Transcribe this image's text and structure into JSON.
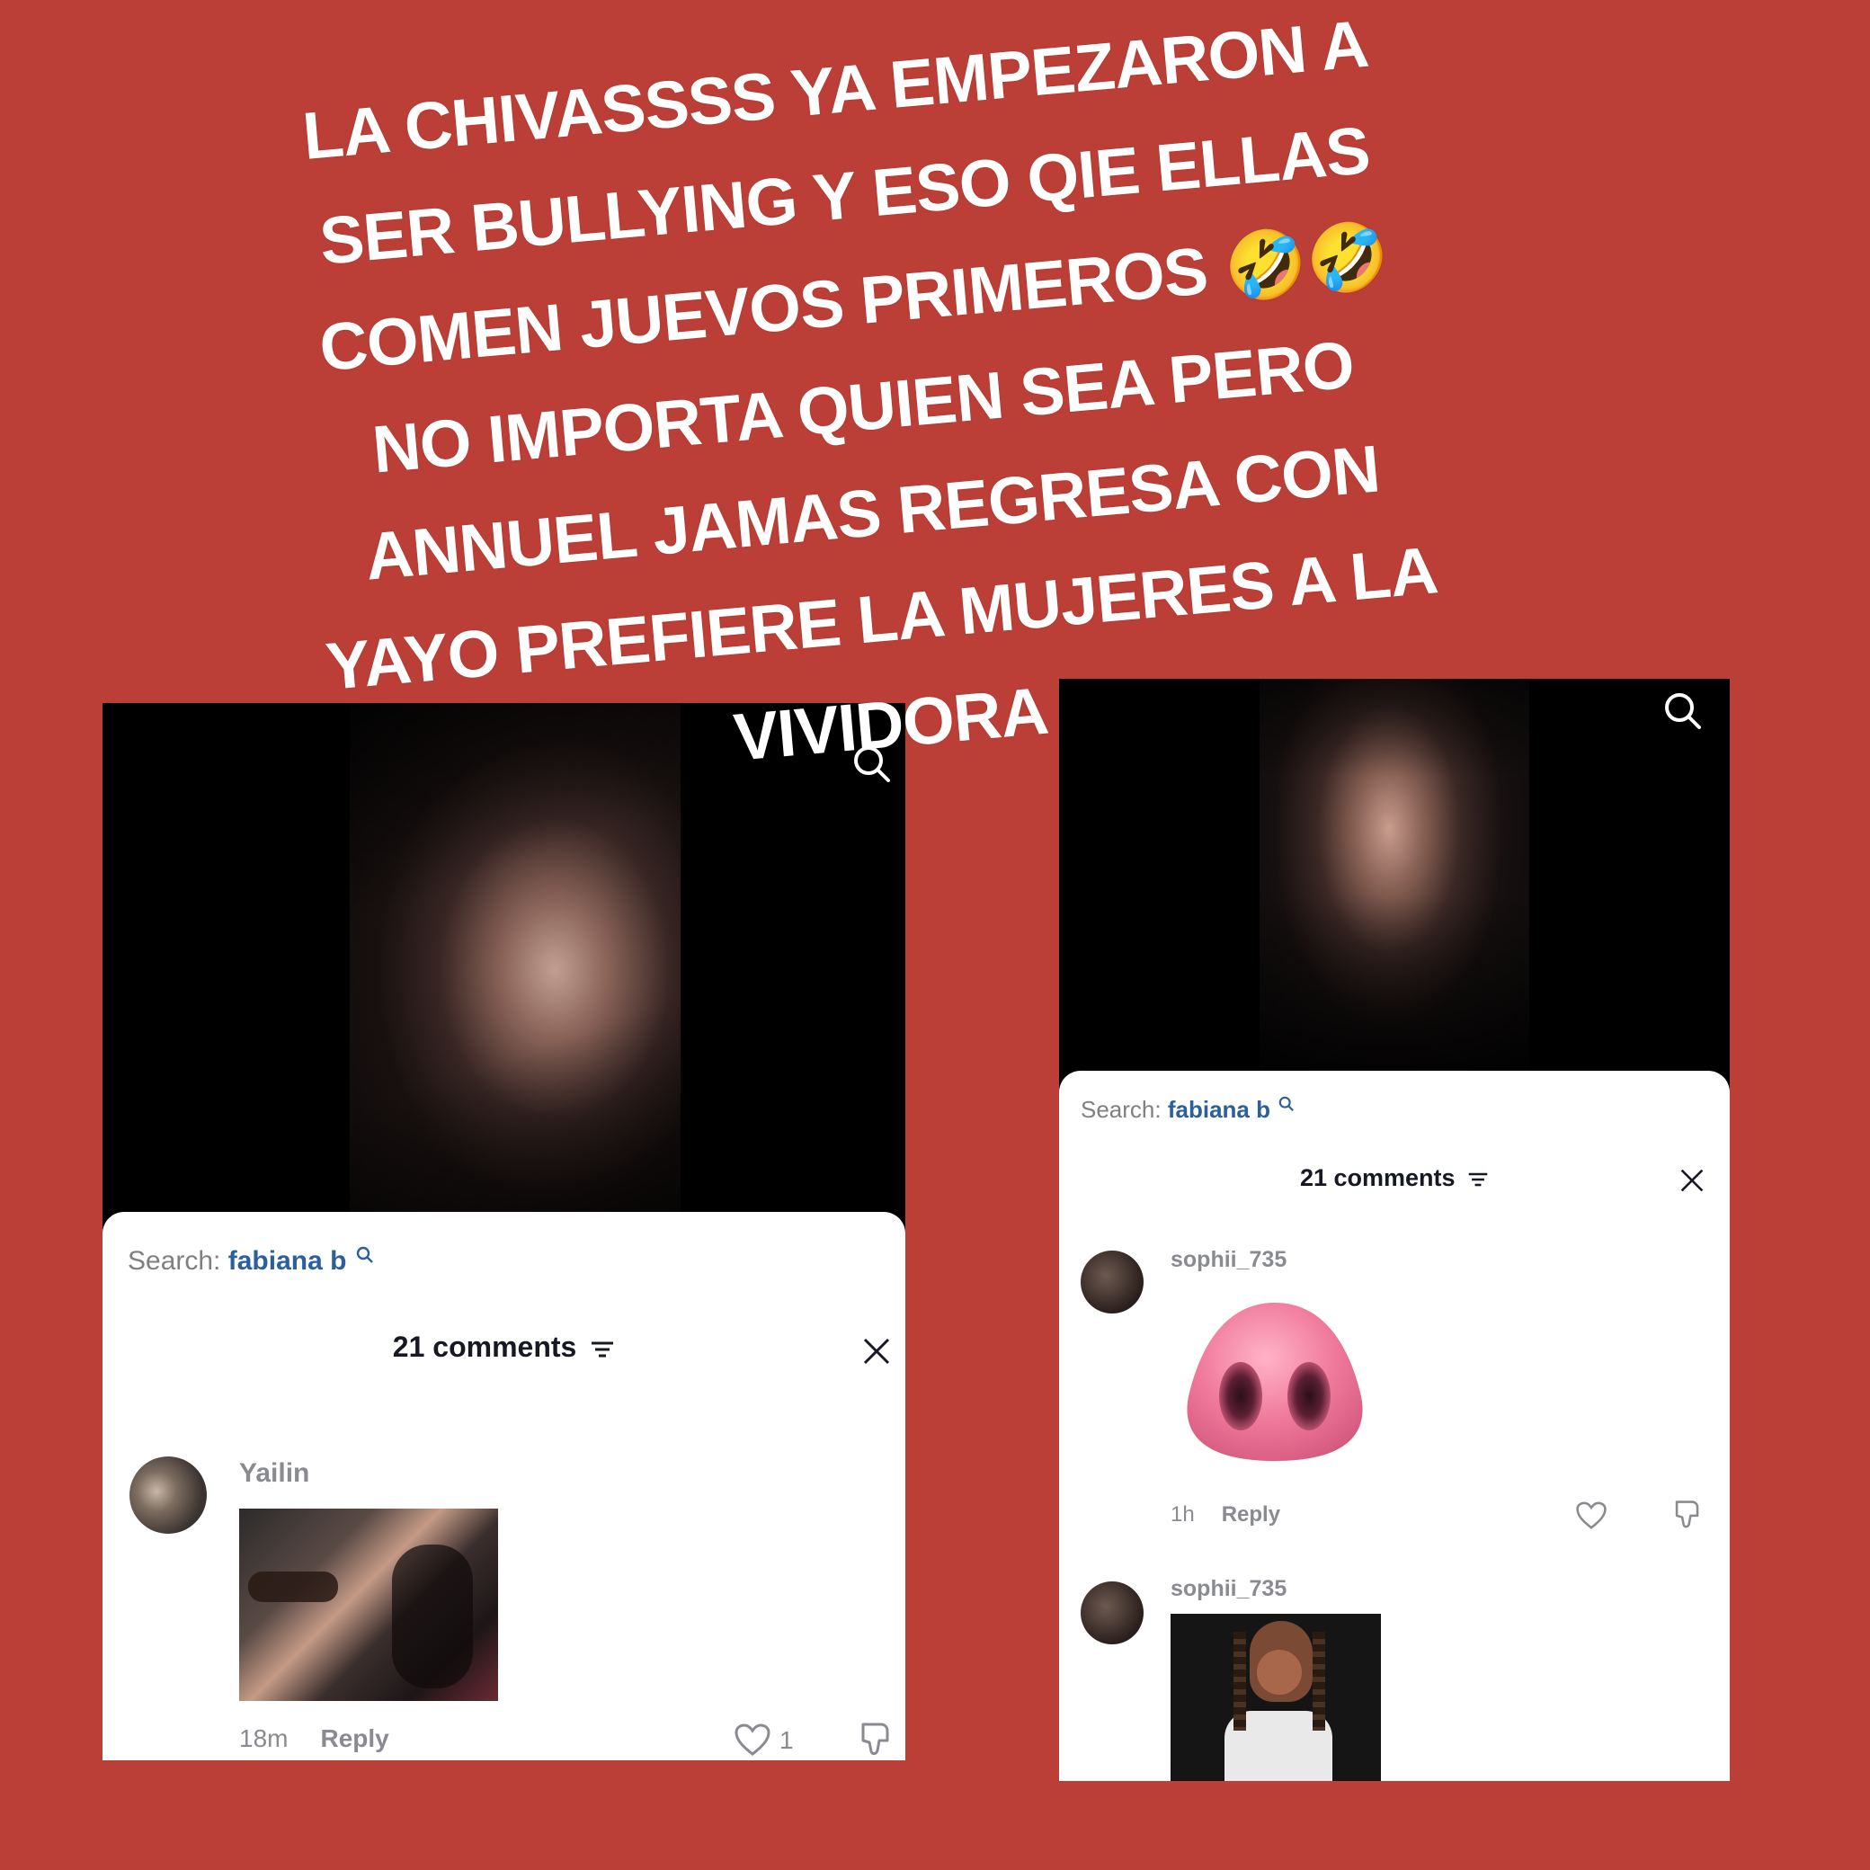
{
  "caption": {
    "lines": [
      "LA CHIVASSSS YA EMPEZARON A",
      "SER BULLYING Y ESO QIE ELLAS",
      "COMEN JUEVOS PRIMEROS 🤣🤣",
      "NO IMPORTA QUIEN SEA PERO",
      "ANNUEL JAMAS REGRESA CON",
      "YAYO PREFIERE LA MUJERES A LA",
      "VIVIDORA"
    ]
  },
  "left_screenshot": {
    "search": {
      "prefix": "Search:",
      "term": "fabiana b"
    },
    "comments_title": "21 comments",
    "comment": {
      "username": "Yailin",
      "time": "18m",
      "reply": "Reply",
      "likes": "1"
    }
  },
  "right_screenshot": {
    "search": {
      "prefix": "Search:",
      "term": "fabiana b"
    },
    "comments_title": "21 comments",
    "comments": [
      {
        "username": "sophii_735",
        "time": "1h",
        "reply": "Reply"
      },
      {
        "username": "sophii_735"
      }
    ]
  },
  "colors": {
    "background": "#bb3f37",
    "caption_text": "#ffffff",
    "search_term": "#2b5f9e",
    "pig_nose": "#f07a9c"
  }
}
